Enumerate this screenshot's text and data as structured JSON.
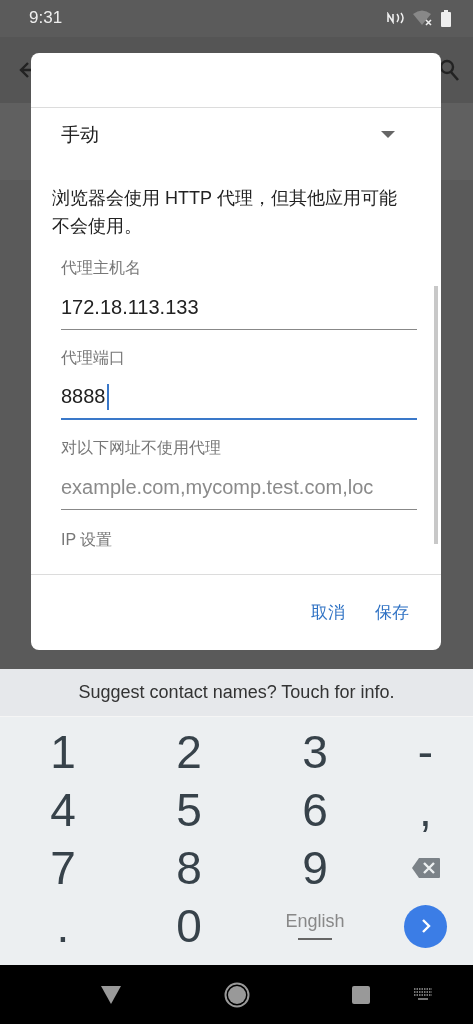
{
  "status_bar": {
    "time": "9:31"
  },
  "dialog": {
    "proxy_mode": {
      "value": "手动"
    },
    "note": "浏览器会使用 HTTP 代理，但其他应用可能不会使用。",
    "fields": [
      {
        "label": "代理主机名",
        "value": "172.18.113.133",
        "focused": false
      },
      {
        "label": "代理端口",
        "value": "8888",
        "focused": true
      },
      {
        "label": "对以下网址不使用代理",
        "placeholder": "example.com,mycomp.test.com,loc",
        "focused": false
      }
    ],
    "section_label": "IP 设置",
    "buttons": [
      "取消",
      "保存"
    ]
  },
  "keyboard": {
    "suggestion": "Suggest contact names? Touch for info.",
    "keys": [
      {
        "kind": "text",
        "label": "1"
      },
      {
        "kind": "text",
        "label": "2"
      },
      {
        "kind": "text",
        "label": "3"
      },
      {
        "kind": "symbol",
        "label": "-"
      },
      {
        "kind": "text",
        "label": "4"
      },
      {
        "kind": "text",
        "label": "5"
      },
      {
        "kind": "text",
        "label": "6"
      },
      {
        "kind": "symbol",
        "label": ","
      },
      {
        "kind": "text",
        "label": "7"
      },
      {
        "kind": "text",
        "label": "8"
      },
      {
        "kind": "text",
        "label": "9"
      },
      {
        "kind": "backspace"
      },
      {
        "kind": "symbol",
        "label": "."
      },
      {
        "kind": "text",
        "label": "0"
      },
      {
        "kind": "language",
        "label": "English"
      },
      {
        "kind": "enter"
      }
    ]
  }
}
